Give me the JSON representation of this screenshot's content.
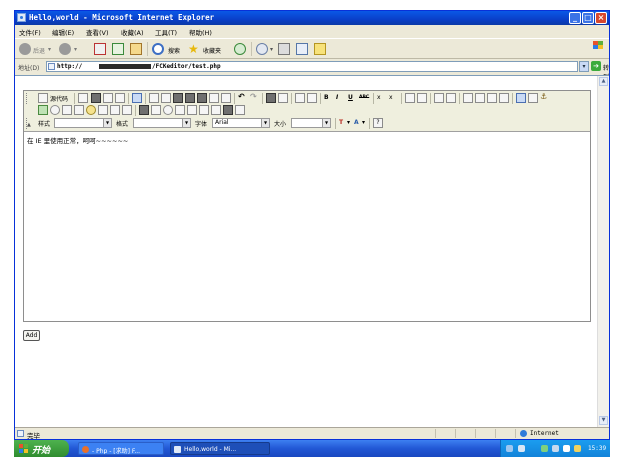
{
  "window": {
    "title": "Hello,world - Microsoft Internet Explorer"
  },
  "menu": [
    "文件(F)",
    "编辑(E)",
    "查看(V)",
    "收藏(A)",
    "工具(T)",
    "帮助(H)"
  ],
  "nav": {
    "back": "后退",
    "search": "搜索",
    "favorites": "收藏夹"
  },
  "address": {
    "label": "地址(D)",
    "protocol": "http://",
    "path": "/FCKeditor/test.php",
    "go_label": "转到"
  },
  "editor": {
    "source_label": "源代码",
    "bold": "B",
    "italic": "I",
    "underline": "U",
    "strike": "ABC",
    "subscript": "x",
    "superscript": "x",
    "style_label": "样式",
    "format_label": "格式",
    "font_label": "字体",
    "font_value": "Arial",
    "size_label": "大小",
    "text_color": "T",
    "bg_color": "A",
    "about": "?",
    "content": "在 IE 里使用正常，呵呵~~~~~~"
  },
  "add_button": "Add",
  "status": {
    "text": "完毕",
    "zone": "Internet"
  },
  "taskbar": {
    "start": "开始",
    "tasks": [
      "- Php - [求助] F...",
      "Hello,world - Mi..."
    ],
    "clock": "15:39"
  },
  "colors": {
    "title_bar": "#0a3fc9",
    "start_button": "#2f8c2f",
    "taskbar": "#2257d5",
    "tray": "#1283d9"
  }
}
